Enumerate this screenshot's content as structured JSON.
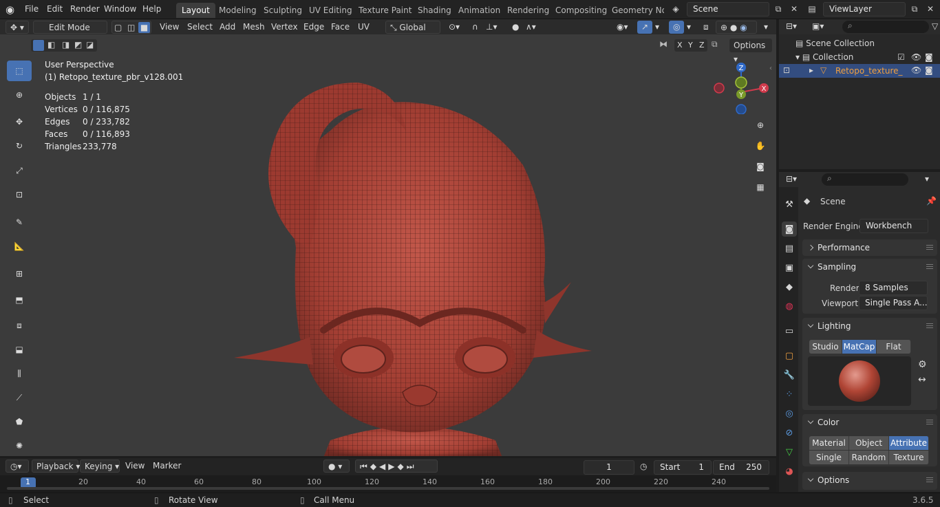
{
  "menu": [
    "File",
    "Edit",
    "Render",
    "Window",
    "Help"
  ],
  "workspaces": [
    "Layout",
    "Modeling",
    "Sculpting",
    "UV Editing",
    "Texture Paint",
    "Shading",
    "Animation",
    "Rendering",
    "Compositing",
    "Geometry Noc"
  ],
  "scene_name": "Scene",
  "view_layer": "ViewLayer",
  "header": {
    "mode": "Edit Mode",
    "view": "View",
    "select": "Select",
    "add": "Add",
    "mesh": "Mesh",
    "vertex": "Vertex",
    "edge": "Edge",
    "face": "Face",
    "uv": "UV",
    "orientation": "Global",
    "options": "Options",
    "axes": [
      "X",
      "Y",
      "Z"
    ]
  },
  "viewport": {
    "perspective": "User Perspective",
    "object_name": "(1) Retopo_texture_pbr_v128.001",
    "stats": [
      {
        "label": "Objects",
        "value": "1 / 1"
      },
      {
        "label": "Vertices",
        "value": "0 / 116,875"
      },
      {
        "label": "Edges",
        "value": "0 / 233,782"
      },
      {
        "label": "Faces",
        "value": "0 / 116,893"
      },
      {
        "label": "Triangles",
        "value": "233,778"
      }
    ],
    "gizmo": {
      "z": "Z",
      "y": "Y",
      "x": "X"
    }
  },
  "outliner": {
    "scene_collection": "Scene Collection",
    "collection": "Collection",
    "object": "Retopo_texture_"
  },
  "properties": {
    "scene": "Scene",
    "render_engine_label": "Render Engine",
    "render_engine": "Workbench",
    "performance": "Performance",
    "sampling": "Sampling",
    "render_label": "Render",
    "render_value": "8 Samples",
    "viewport_label": "Viewport",
    "viewport_value": "Single Pass A...",
    "lighting": "Lighting",
    "lighting_opts": [
      "Studio",
      "MatCap",
      "Flat"
    ],
    "color": "Color",
    "color_opts": [
      "Material",
      "Object",
      "Attribute",
      "Single",
      "Random",
      "Texture"
    ],
    "options": "Options"
  },
  "timeline": {
    "playback": "Playback",
    "keying": "Keying",
    "view": "View",
    "marker": "Marker",
    "current": "1",
    "start_label": "Start",
    "start": "1",
    "end_label": "End",
    "end": "250",
    "ticks": [
      "1",
      "20",
      "40",
      "60",
      "80",
      "100",
      "120",
      "140",
      "160",
      "180",
      "200",
      "220",
      "240"
    ]
  },
  "status": {
    "select": "Select",
    "rotate": "Rotate View",
    "call_menu": "Call Menu",
    "version": "3.6.5"
  },
  "colors": {
    "accent": "#4772b3",
    "model": "#b0463a",
    "bg": "#3b3b3b"
  }
}
